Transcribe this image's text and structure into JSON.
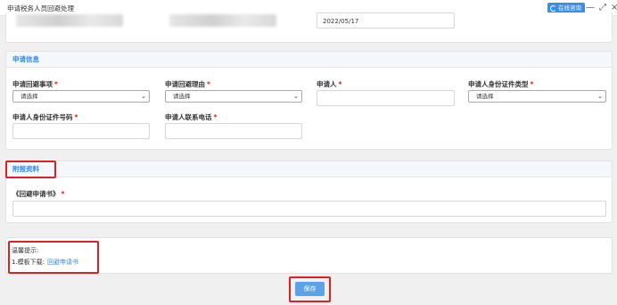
{
  "window": {
    "title": "申请税务人员回避处理",
    "consult_label": "在线咨询",
    "minimize_glyph": "—",
    "maximize_glyph": "⤢",
    "close_glyph": "×"
  },
  "top_section": {
    "date_value": "2022/05/17"
  },
  "apply_section": {
    "heading": "申请信息",
    "fields": {
      "matter_label": "申请回避事项",
      "matter_value": "请选择",
      "reason_label": "申请回避理由",
      "reason_value": "请选择",
      "applicant_label": "申请人",
      "applicant_value": "",
      "id_type_label": "申请人身份证件类型",
      "id_type_value": "请选择",
      "id_number_label": "申请人身份证件号码",
      "id_number_value": "",
      "phone_label": "申请人联系电话",
      "phone_value": ""
    },
    "required_mark": "*"
  },
  "attachment_section": {
    "heading": "附报资料",
    "doc_label": "《回避申请书》",
    "required_mark": "*",
    "doc_value": ""
  },
  "tips": {
    "title": "温馨提示:",
    "line_prefix": "1.模板下载:",
    "link_text": "回避申请书"
  },
  "actions": {
    "save_label": "保存"
  },
  "colors": {
    "accent": "#2d8cf0",
    "highlight_box": "#e02020",
    "save_button": "#5ba3e8"
  }
}
